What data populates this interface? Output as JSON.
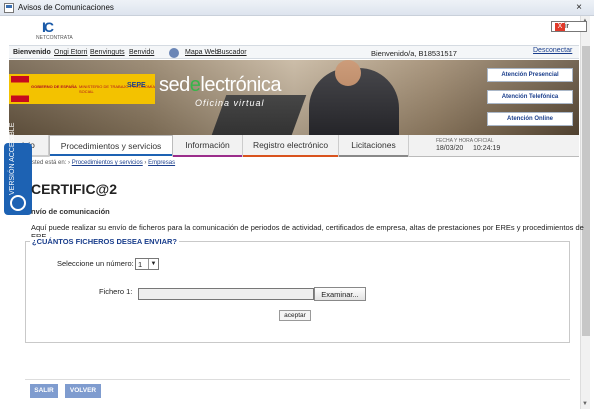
{
  "window": {
    "title": "Avisos de Comunicaciones",
    "close_glyph": "×"
  },
  "logo": {
    "mark": "IC",
    "label": "NETCONTRATA"
  },
  "salir_top": {
    "label": "Salir",
    "x": "X"
  },
  "toplinks": {
    "items": [
      "Bienvenido",
      "Ongi Etorri",
      "Benvinguts",
      "Benvido",
      "Mapa Web",
      "Buscador"
    ],
    "welcome": "Bienvenido/a, B18531517",
    "logout": "Desconectar"
  },
  "banner": {
    "gov_line1": "GOBIERNO DE ESPAÑA",
    "gov_line2": "MINISTERIO DE TRABAJO Y ECONOMÍA SOCIAL",
    "sepe": "SEPE",
    "sede_a": "sed",
    "sede_e": "e",
    "sede_b": "lectrónica",
    "oficina": "Oficina virtual",
    "attention": [
      "Atención Presencial",
      "Atención Telefónica",
      "Atención Online"
    ]
  },
  "nav": {
    "tabs": [
      {
        "label": "icio",
        "color": "#cccccc"
      },
      {
        "label": "Procedimientos y servicios",
        "color": "#1d62b3"
      },
      {
        "label": "Información",
        "color": "#9b2d8b"
      },
      {
        "label": "Registro electrónico",
        "color": "#d9531e"
      },
      {
        "label": "Licitaciones",
        "color": "#888888"
      }
    ],
    "date_label": "FECHA Y HORA OFICIAL",
    "date": "18/03/20",
    "time": "10:24:19"
  },
  "breadcrumb": {
    "prefix": "sted está en: ›",
    "item1": "Procedimientos y servicios",
    "sep": "›",
    "item2": "Empresas"
  },
  "accessibility": {
    "label": "VERSIÓN ACCESIBLE"
  },
  "page": {
    "title": "CERTIFIC@2",
    "section": "nvío de comunicación",
    "description": "Aquí puede realizar su envío de ficheros para la comunicación de periodos de actividad, certificados de empresa, altas de prestaciones por EREs y procedimientos de ERE"
  },
  "form": {
    "legend": "¿CUÁNTOS FICHEROS DESEA ENVIAR?",
    "number_label": "Seleccione un número:",
    "number_value": "1",
    "file_label": "Fichero 1:",
    "file_value": "",
    "browse_label": "Examinar...",
    "accept_label": "aceptar"
  },
  "footer": {
    "salir": "SALIR",
    "volver": "VOLVER"
  }
}
